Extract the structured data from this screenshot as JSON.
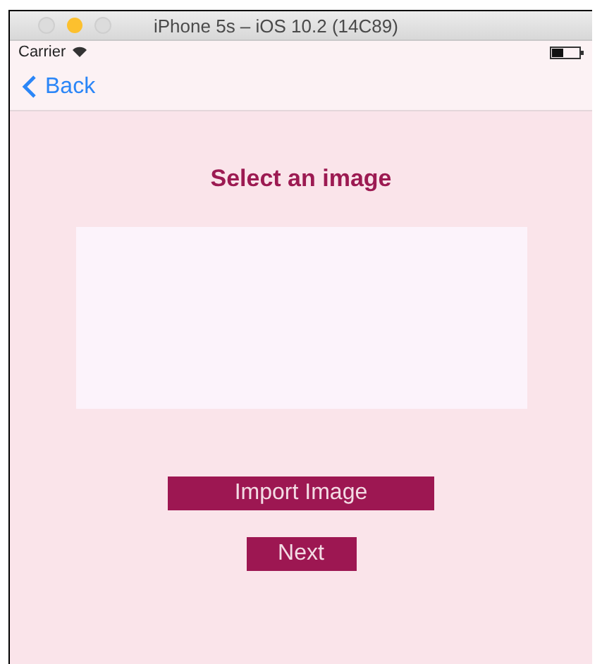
{
  "window": {
    "title": "iPhone 5s – iOS 10.2 (14C89)"
  },
  "status_bar": {
    "carrier": "Carrier"
  },
  "navigation_bar": {
    "back": "Back"
  },
  "heading": "Select an image",
  "buttons": [
    {
      "label": "Import Image"
    },
    {
      "label": "Next"
    }
  ]
}
